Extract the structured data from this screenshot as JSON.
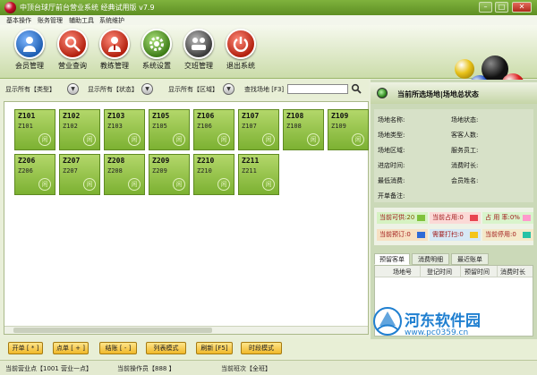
{
  "window": {
    "title": "中顶台球厅前台营业系统 经典试用版 v7.9"
  },
  "menu": [
    "基本操作",
    "账务管理",
    "辅助工具",
    "系统维护"
  ],
  "toolbar": [
    {
      "label": "会员管理",
      "icon": "member-icon",
      "color": "#2f79c8"
    },
    {
      "label": "营业查询",
      "icon": "search-icon",
      "color": "#d23a2a"
    },
    {
      "label": "教练管理",
      "icon": "coach-icon",
      "color": "#d23a2a"
    },
    {
      "label": "系统设置",
      "icon": "gear-icon",
      "color": "#5a9a2a"
    },
    {
      "label": "交班管理",
      "icon": "shift-icon",
      "color": "#5a5a5a"
    },
    {
      "label": "退出系统",
      "icon": "power-icon",
      "color": "#d23a2a"
    }
  ],
  "filters": {
    "type": "显示所有【类型】",
    "status": "显示所有【状态】",
    "area": "显示所有【区域】",
    "search_label": "查找场地 [F3]",
    "search_value": ""
  },
  "tables": [
    {
      "name": "Z101",
      "sub": "Z101"
    },
    {
      "name": "Z102",
      "sub": "Z102"
    },
    {
      "name": "Z103",
      "sub": "Z103"
    },
    {
      "name": "Z105",
      "sub": "Z105"
    },
    {
      "name": "Z106",
      "sub": "Z106"
    },
    {
      "name": "Z107",
      "sub": "Z107"
    },
    {
      "name": "Z108",
      "sub": "Z108"
    },
    {
      "name": "Z109",
      "sub": "Z109"
    },
    {
      "name": "Z206",
      "sub": "Z206"
    },
    {
      "name": "Z207",
      "sub": "Z207"
    },
    {
      "name": "Z208",
      "sub": "Z208"
    },
    {
      "name": "Z209",
      "sub": "Z209"
    },
    {
      "name": "Z210",
      "sub": "Z210"
    },
    {
      "name": "Z211",
      "sub": "Z211"
    }
  ],
  "table_mark": "闲",
  "actions": [
    "开单 [ * ]",
    "点单 [ + ]",
    "结账 [ - ]",
    "列表模式",
    "刷新 [F5]",
    "时段模式"
  ],
  "status_bar": {
    "point": "当前营业点【1001 营业一点】",
    "operator": "当前操作员【888 】",
    "shift": "当前班次【全班】"
  },
  "panel": {
    "title": "当前所选场地|场地总状态",
    "left_fields": [
      "场地名称:",
      "场地类型:",
      "场地区域:",
      "进店时间:",
      "最低消费:",
      "开单备注:"
    ],
    "right_fields": [
      "场地状态:",
      "客客人数:",
      "服务员工:",
      "消费时长:",
      "会员姓名:"
    ],
    "legend": [
      {
        "label": "当前可供:",
        "value": "20",
        "color": "#7fc13b"
      },
      {
        "label": "当前占用:",
        "value": "0",
        "color": "#e8434f"
      },
      {
        "label": "占 用 率:",
        "value": "0%",
        "color": "#ff99cc"
      },
      {
        "label": "当前预订:",
        "value": "0",
        "color": "#2f6ad6"
      },
      {
        "label": "需要打扫:",
        "value": "0",
        "color": "#f5c51a"
      },
      {
        "label": "当前停用:",
        "value": "0",
        "color": "#27c2a6"
      }
    ],
    "tabs": [
      "预留客单",
      "消费明细",
      "最近账单"
    ],
    "grid_headers": [
      "场地号",
      "登记时间",
      "预留时间",
      "消费时长"
    ]
  },
  "watermark": {
    "brand": "河东软件园",
    "url": "www.pc0359.cn"
  }
}
